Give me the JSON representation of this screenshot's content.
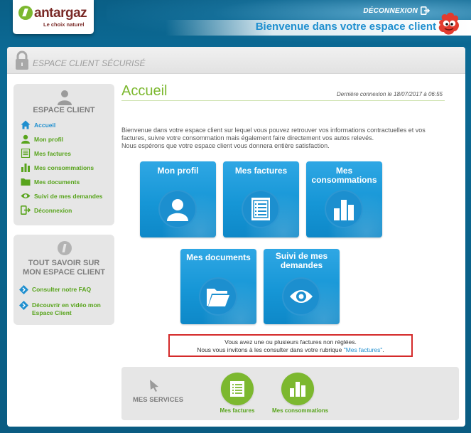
{
  "header": {
    "logo_text": "antargaz",
    "logo_tagline": "Le choix naturel",
    "logout_label": "DÉCONNEXION",
    "welcome": "Bienvenue dans votre espace client"
  },
  "secure_bar": {
    "label": "ESPACE CLIENT SÉCURISÉ"
  },
  "sidebar": {
    "heading": "ESPACE CLIENT",
    "items": [
      {
        "label": "Accueil",
        "icon": "home-icon"
      },
      {
        "label": "Mon profil",
        "icon": "user-icon"
      },
      {
        "label": "Mes factures",
        "icon": "invoice-icon"
      },
      {
        "label": "Mes consommations",
        "icon": "bar-chart-icon"
      },
      {
        "label": "Mes documents",
        "icon": "folder-icon"
      },
      {
        "label": "Suivi de mes demandes",
        "icon": "eye-icon"
      },
      {
        "label": "Déconnexion",
        "icon": "logout-icon"
      }
    ]
  },
  "help_box": {
    "heading_line1": "TOUT SAVOIR SUR",
    "heading_line2": "MON ESPACE CLIENT",
    "items": [
      {
        "label": "Consulter notre FAQ"
      },
      {
        "label": "Découvrir en vidéo mon Espace Client"
      }
    ]
  },
  "main": {
    "title": "Accueil",
    "last_login": "Dernière connexion le 18/07/2017 à 06:55",
    "intro_line1": "Bienvenue dans votre espace client sur lequel vous pouvez retrouver vos informations contractuelles et vos factures, suivre votre consommation mais également faire directement vos autos relevés.",
    "intro_line2": "Nous espérons que votre espace client vous donnera entière satisfaction.",
    "tiles": [
      {
        "label": "Mon profil",
        "icon": "user-icon"
      },
      {
        "label": "Mes factures",
        "icon": "invoice-icon"
      },
      {
        "label": "Mes consommations",
        "icon": "bar-chart-icon"
      },
      {
        "label": "Mes documents",
        "icon": "folder-icon"
      },
      {
        "label": "Suivi de mes demandes",
        "icon": "eye-icon"
      }
    ],
    "alert": {
      "line1": "Vous avez une ou plusieurs factures non réglées.",
      "line2_before": "Nous vous invitons à les consulter dans votre rubrique ",
      "line2_link": "\"Mes factures\"",
      "line2_after": "."
    }
  },
  "services": {
    "label": "MES SERVICES",
    "items": [
      {
        "label": "Mes factures",
        "icon": "invoice-icon"
      },
      {
        "label": "Mes consommations",
        "icon": "bar-chart-icon"
      }
    ]
  },
  "colors": {
    "brand_green": "#7cb82f",
    "tile_blue": "#1696d6",
    "alert_red": "#d42a2a",
    "header_blue": "#0a5f86"
  }
}
